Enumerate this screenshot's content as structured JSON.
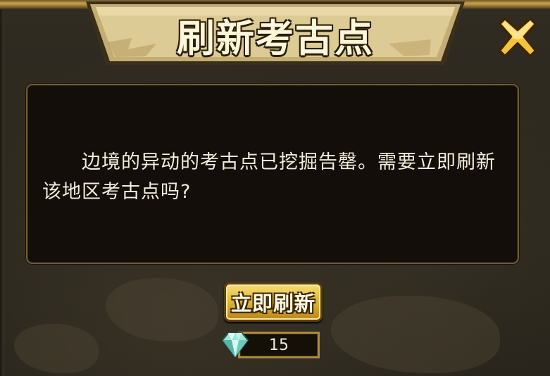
{
  "dialog": {
    "title": "刷新考古点",
    "message": "边境的异动的考古点已挖掘告罄。需要立即刷新该地区考古点吗?",
    "refresh_button_label": "立即刷新",
    "cost": {
      "currency_icon": "diamond-icon",
      "amount": "15"
    },
    "close_icon": "close-x-icon"
  },
  "colors": {
    "title_text": "#fdf6d8",
    "banner_parchment": "#d9c58e",
    "gold_button": "#e2b834",
    "message_bg": "#140e0a",
    "panel_bg": "#2b271e"
  }
}
